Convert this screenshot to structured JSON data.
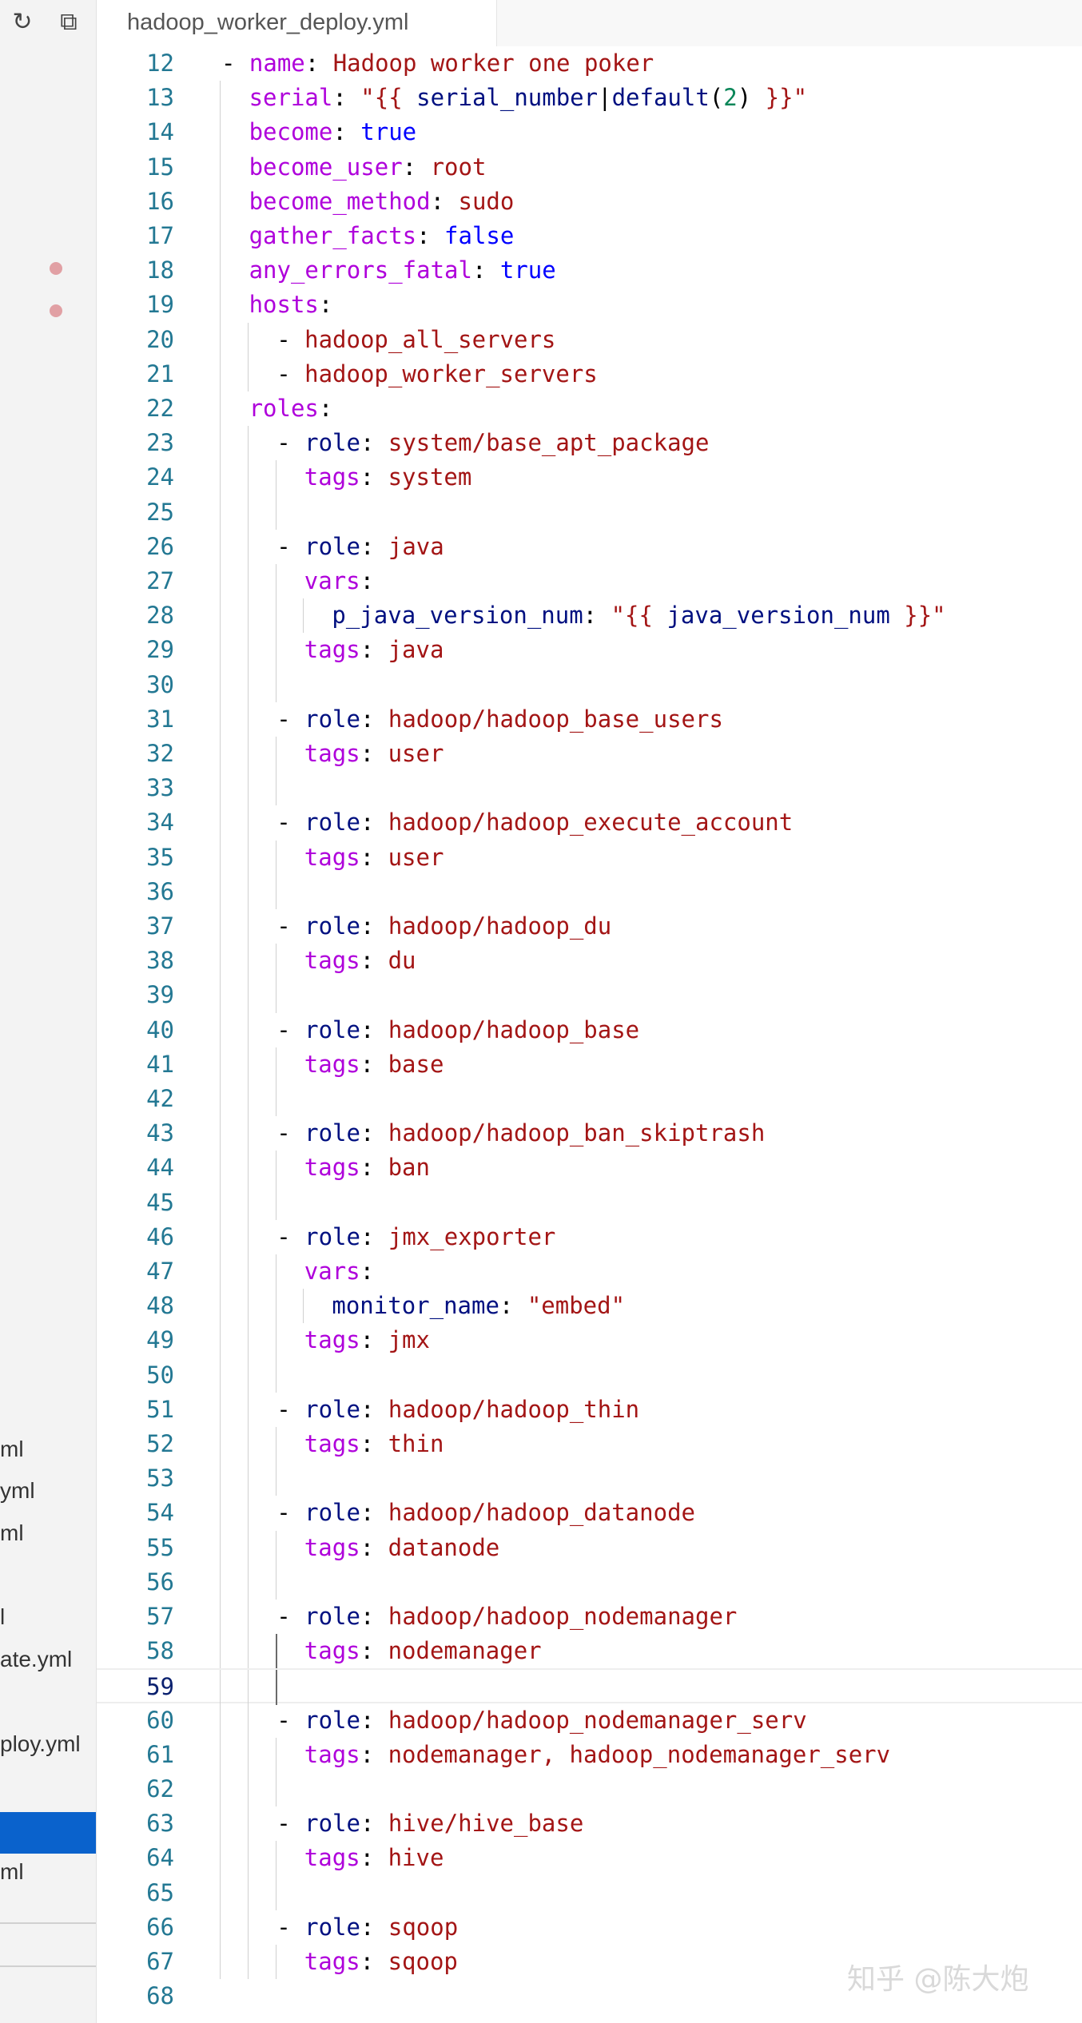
{
  "tab": {
    "title": "hadoop_worker_deploy.yml"
  },
  "sidebar": {
    "toolbar_icons": [
      "refresh-icon",
      "collapse-all-icon"
    ],
    "file_fragments": [
      "ml",
      "yml",
      "ml",
      "l",
      "ate.yml",
      "ploy.yml",
      "ml"
    ]
  },
  "editor": {
    "current_line": 59,
    "lines": [
      {
        "n": "12",
        "indent": 0,
        "tokens": [
          [
            "p",
            "- "
          ],
          [
            "a",
            "name"
          ],
          [
            "p",
            ": "
          ],
          [
            "m",
            "Hadoop worker one poker"
          ]
        ]
      },
      {
        "n": "13",
        "indent": 1,
        "tokens": [
          [
            "a",
            "serial"
          ],
          [
            "p",
            ": "
          ],
          [
            "m",
            "\"{{ "
          ],
          [
            "t",
            "serial_number"
          ],
          [
            "p",
            "|"
          ],
          [
            "t",
            "default"
          ],
          [
            "p",
            "("
          ],
          [
            "n",
            "2"
          ],
          [
            "p",
            ")"
          ],
          [
            "m",
            " }}\""
          ]
        ]
      },
      {
        "n": "14",
        "indent": 1,
        "tokens": [
          [
            "a",
            "become"
          ],
          [
            "p",
            ": "
          ],
          [
            "b",
            "true"
          ]
        ]
      },
      {
        "n": "15",
        "indent": 1,
        "tokens": [
          [
            "a",
            "become_user"
          ],
          [
            "p",
            ": "
          ],
          [
            "m",
            "root"
          ]
        ]
      },
      {
        "n": "16",
        "indent": 1,
        "tokens": [
          [
            "a",
            "become_method"
          ],
          [
            "p",
            ": "
          ],
          [
            "m",
            "sudo"
          ]
        ]
      },
      {
        "n": "17",
        "indent": 1,
        "tokens": [
          [
            "a",
            "gather_facts"
          ],
          [
            "p",
            ": "
          ],
          [
            "b",
            "false"
          ]
        ]
      },
      {
        "n": "18",
        "indent": 1,
        "tokens": [
          [
            "a",
            "any_errors_fatal"
          ],
          [
            "p",
            ": "
          ],
          [
            "b",
            "true"
          ]
        ]
      },
      {
        "n": "19",
        "indent": 1,
        "tokens": [
          [
            "a",
            "hosts"
          ],
          [
            "p",
            ":"
          ]
        ]
      },
      {
        "n": "20",
        "indent": 2,
        "tokens": [
          [
            "p",
            "- "
          ],
          [
            "m",
            "hadoop_all_servers"
          ]
        ]
      },
      {
        "n": "21",
        "indent": 2,
        "tokens": [
          [
            "p",
            "- "
          ],
          [
            "m",
            "hadoop_worker_servers"
          ]
        ]
      },
      {
        "n": "22",
        "indent": 1,
        "tokens": [
          [
            "a",
            "roles"
          ],
          [
            "p",
            ":"
          ]
        ]
      },
      {
        "n": "23",
        "indent": 2,
        "tokens": [
          [
            "p",
            "- "
          ],
          [
            "t",
            "role"
          ],
          [
            "p",
            ": "
          ],
          [
            "m",
            "system/base_apt_package"
          ]
        ]
      },
      {
        "n": "24",
        "indent": 3,
        "tokens": [
          [
            "a",
            "tags"
          ],
          [
            "p",
            ": "
          ],
          [
            "m",
            "system"
          ]
        ]
      },
      {
        "n": "25",
        "indent": 3,
        "tokens": []
      },
      {
        "n": "26",
        "indent": 2,
        "tokens": [
          [
            "p",
            "- "
          ],
          [
            "t",
            "role"
          ],
          [
            "p",
            ": "
          ],
          [
            "m",
            "java"
          ]
        ]
      },
      {
        "n": "27",
        "indent": 3,
        "tokens": [
          [
            "a",
            "vars"
          ],
          [
            "p",
            ":"
          ]
        ]
      },
      {
        "n": "28",
        "indent": 4,
        "tokens": [
          [
            "t",
            "p_java_version_num"
          ],
          [
            "p",
            ": "
          ],
          [
            "m",
            "\"{{ "
          ],
          [
            "t",
            "java_version_num"
          ],
          [
            "m",
            " }}\""
          ]
        ]
      },
      {
        "n": "29",
        "indent": 3,
        "tokens": [
          [
            "a",
            "tags"
          ],
          [
            "p",
            ": "
          ],
          [
            "m",
            "java"
          ]
        ]
      },
      {
        "n": "30",
        "indent": 3,
        "tokens": []
      },
      {
        "n": "31",
        "indent": 2,
        "tokens": [
          [
            "p",
            "- "
          ],
          [
            "t",
            "role"
          ],
          [
            "p",
            ": "
          ],
          [
            "m",
            "hadoop/hadoop_base_users"
          ]
        ]
      },
      {
        "n": "32",
        "indent": 3,
        "tokens": [
          [
            "a",
            "tags"
          ],
          [
            "p",
            ": "
          ],
          [
            "m",
            "user"
          ]
        ]
      },
      {
        "n": "33",
        "indent": 3,
        "tokens": []
      },
      {
        "n": "34",
        "indent": 2,
        "tokens": [
          [
            "p",
            "- "
          ],
          [
            "t",
            "role"
          ],
          [
            "p",
            ": "
          ],
          [
            "m",
            "hadoop/hadoop_execute_account"
          ]
        ]
      },
      {
        "n": "35",
        "indent": 3,
        "tokens": [
          [
            "a",
            "tags"
          ],
          [
            "p",
            ": "
          ],
          [
            "m",
            "user"
          ]
        ]
      },
      {
        "n": "36",
        "indent": 3,
        "tokens": []
      },
      {
        "n": "37",
        "indent": 2,
        "tokens": [
          [
            "p",
            "- "
          ],
          [
            "t",
            "role"
          ],
          [
            "p",
            ": "
          ],
          [
            "m",
            "hadoop/hadoop_du"
          ]
        ]
      },
      {
        "n": "38",
        "indent": 3,
        "tokens": [
          [
            "a",
            "tags"
          ],
          [
            "p",
            ": "
          ],
          [
            "m",
            "du"
          ]
        ]
      },
      {
        "n": "39",
        "indent": 3,
        "tokens": []
      },
      {
        "n": "40",
        "indent": 2,
        "tokens": [
          [
            "p",
            "- "
          ],
          [
            "t",
            "role"
          ],
          [
            "p",
            ": "
          ],
          [
            "m",
            "hadoop/hadoop_base"
          ]
        ]
      },
      {
        "n": "41",
        "indent": 3,
        "tokens": [
          [
            "a",
            "tags"
          ],
          [
            "p",
            ": "
          ],
          [
            "m",
            "base"
          ]
        ]
      },
      {
        "n": "42",
        "indent": 3,
        "tokens": []
      },
      {
        "n": "43",
        "indent": 2,
        "tokens": [
          [
            "p",
            "- "
          ],
          [
            "t",
            "role"
          ],
          [
            "p",
            ": "
          ],
          [
            "m",
            "hadoop/hadoop_ban_skiptrash"
          ]
        ]
      },
      {
        "n": "44",
        "indent": 3,
        "tokens": [
          [
            "a",
            "tags"
          ],
          [
            "p",
            ": "
          ],
          [
            "m",
            "ban"
          ]
        ]
      },
      {
        "n": "45",
        "indent": 3,
        "tokens": []
      },
      {
        "n": "46",
        "indent": 2,
        "tokens": [
          [
            "p",
            "- "
          ],
          [
            "t",
            "role"
          ],
          [
            "p",
            ": "
          ],
          [
            "m",
            "jmx_exporter"
          ]
        ]
      },
      {
        "n": "47",
        "indent": 3,
        "tokens": [
          [
            "a",
            "vars"
          ],
          [
            "p",
            ":"
          ]
        ]
      },
      {
        "n": "48",
        "indent": 4,
        "tokens": [
          [
            "t",
            "monitor_name"
          ],
          [
            "p",
            ": "
          ],
          [
            "m",
            "\"embed\""
          ]
        ]
      },
      {
        "n": "49",
        "indent": 3,
        "tokens": [
          [
            "a",
            "tags"
          ],
          [
            "p",
            ": "
          ],
          [
            "m",
            "jmx"
          ]
        ]
      },
      {
        "n": "50",
        "indent": 3,
        "tokens": []
      },
      {
        "n": "51",
        "indent": 2,
        "tokens": [
          [
            "p",
            "- "
          ],
          [
            "t",
            "role"
          ],
          [
            "p",
            ": "
          ],
          [
            "m",
            "hadoop/hadoop_thin"
          ]
        ]
      },
      {
        "n": "52",
        "indent": 3,
        "tokens": [
          [
            "a",
            "tags"
          ],
          [
            "p",
            ": "
          ],
          [
            "m",
            "thin"
          ]
        ]
      },
      {
        "n": "53",
        "indent": 3,
        "tokens": []
      },
      {
        "n": "54",
        "indent": 2,
        "tokens": [
          [
            "p",
            "- "
          ],
          [
            "t",
            "role"
          ],
          [
            "p",
            ": "
          ],
          [
            "m",
            "hadoop/hadoop_datanode"
          ]
        ]
      },
      {
        "n": "55",
        "indent": 3,
        "tokens": [
          [
            "a",
            "tags"
          ],
          [
            "p",
            ": "
          ],
          [
            "m",
            "datanode"
          ]
        ]
      },
      {
        "n": "56",
        "indent": 3,
        "tokens": []
      },
      {
        "n": "57",
        "indent": 2,
        "tokens": [
          [
            "p",
            "- "
          ],
          [
            "t",
            "role"
          ],
          [
            "p",
            ": "
          ],
          [
            "m",
            "hadoop/hadoop_nodemanager"
          ]
        ]
      },
      {
        "n": "58",
        "indent": 3,
        "active": true,
        "tokens": [
          [
            "a",
            "tags"
          ],
          [
            "p",
            ": "
          ],
          [
            "m",
            "nodemanager"
          ]
        ]
      },
      {
        "n": "59",
        "indent": 3,
        "active": true,
        "tokens": []
      },
      {
        "n": "60",
        "indent": 2,
        "tokens": [
          [
            "p",
            "- "
          ],
          [
            "t",
            "role"
          ],
          [
            "p",
            ": "
          ],
          [
            "m",
            "hadoop/hadoop_nodemanager_serv"
          ]
        ]
      },
      {
        "n": "61",
        "indent": 3,
        "tokens": [
          [
            "a",
            "tags"
          ],
          [
            "p",
            ": "
          ],
          [
            "m",
            "nodemanager, hadoop_nodemanager_serv"
          ]
        ]
      },
      {
        "n": "62",
        "indent": 3,
        "tokens": []
      },
      {
        "n": "63",
        "indent": 2,
        "tokens": [
          [
            "p",
            "- "
          ],
          [
            "t",
            "role"
          ],
          [
            "p",
            ": "
          ],
          [
            "m",
            "hive/hive_base"
          ]
        ]
      },
      {
        "n": "64",
        "indent": 3,
        "tokens": [
          [
            "a",
            "tags"
          ],
          [
            "p",
            ": "
          ],
          [
            "m",
            "hive"
          ]
        ]
      },
      {
        "n": "65",
        "indent": 3,
        "tokens": []
      },
      {
        "n": "66",
        "indent": 2,
        "tokens": [
          [
            "p",
            "- "
          ],
          [
            "t",
            "role"
          ],
          [
            "p",
            ": "
          ],
          [
            "m",
            "sqoop"
          ]
        ]
      },
      {
        "n": "67",
        "indent": 3,
        "tokens": [
          [
            "a",
            "tags"
          ],
          [
            "p",
            ": "
          ],
          [
            "m",
            "sqoop"
          ]
        ]
      },
      {
        "n": "68",
        "indent": 0,
        "tokens": []
      }
    ]
  },
  "watermark": "知乎 @陈大炮"
}
